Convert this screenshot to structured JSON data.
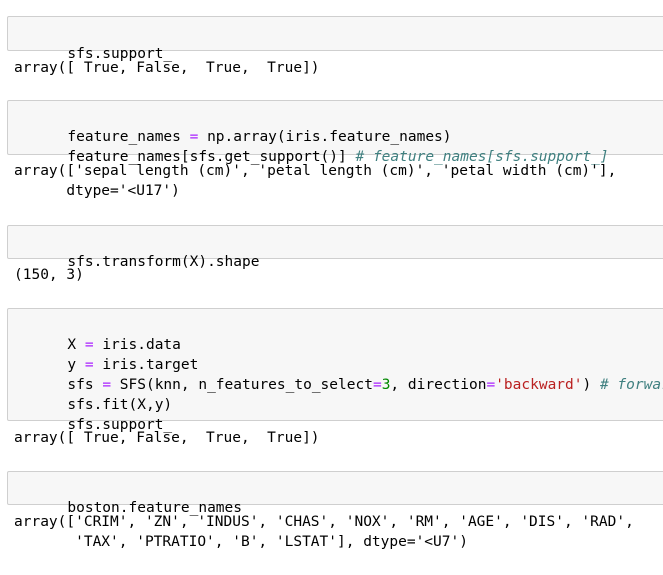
{
  "cells": [
    {
      "input_lines": [
        [
          {
            "t": "sfs.support_",
            "c": ""
          }
        ]
      ],
      "output_lines": [
        "array([ True, False,  True,  True])"
      ]
    },
    {
      "input_lines": [
        [
          {
            "t": "feature_names ",
            "c": ""
          },
          {
            "t": "=",
            "c": "op"
          },
          {
            "t": " np.array(iris.feature_names)",
            "c": ""
          }
        ],
        [
          {
            "t": "feature_names[sfs.get_support()] ",
            "c": ""
          },
          {
            "t": "# feature_names[sfs.support_]",
            "c": "cmt"
          }
        ]
      ],
      "output_lines": [
        "array(['sepal length (cm)', 'petal length (cm)', 'petal width (cm)'],",
        "      dtype='<U17')"
      ]
    },
    {
      "input_lines": [
        [
          {
            "t": "sfs.transform(X).shape",
            "c": ""
          }
        ]
      ],
      "output_lines": [
        "(150, 3)"
      ]
    },
    {
      "input_lines": [
        [
          {
            "t": "X ",
            "c": ""
          },
          {
            "t": "=",
            "c": "op"
          },
          {
            "t": " iris.data",
            "c": ""
          }
        ],
        [
          {
            "t": "y ",
            "c": ""
          },
          {
            "t": "=",
            "c": "op"
          },
          {
            "t": " iris.target",
            "c": ""
          }
        ],
        [
          {
            "t": "sfs ",
            "c": ""
          },
          {
            "t": "=",
            "c": "op"
          },
          {
            "t": " SFS(knn, n_features_to_select",
            "c": ""
          },
          {
            "t": "=",
            "c": "op"
          },
          {
            "t": "3",
            "c": "num"
          },
          {
            "t": ", direction",
            "c": ""
          },
          {
            "t": "=",
            "c": "op"
          },
          {
            "t": "'backward'",
            "c": "str"
          },
          {
            "t": ") ",
            "c": ""
          },
          {
            "t": "# forward",
            "c": "cmt"
          }
        ],
        [
          {
            "t": "sfs.fit(X,y)",
            "c": ""
          }
        ],
        [
          {
            "t": "sfs.support_",
            "c": ""
          }
        ]
      ],
      "output_lines": [
        "array([ True, False,  True,  True])"
      ]
    },
    {
      "input_lines": [
        [
          {
            "t": "boston.feature_names",
            "c": ""
          }
        ]
      ],
      "output_lines": [
        "array(['CRIM', 'ZN', 'INDUS', 'CHAS', 'NOX', 'RM', 'AGE', 'DIS', 'RAD',",
        "       'TAX', 'PTRATIO', 'B', 'LSTAT'], dtype='<U7')"
      ]
    }
  ]
}
